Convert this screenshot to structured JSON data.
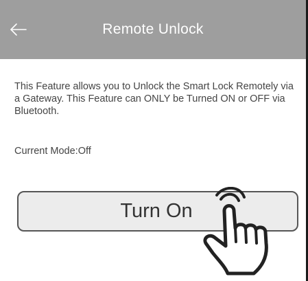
{
  "header": {
    "back_icon": "arrow-left-icon",
    "title": "Remote Unlock",
    "background_color": "#9e9e9e",
    "title_color": "#ffffff"
  },
  "content": {
    "description": "This Feature allows you to Unlock the Smart Lock Remotely via a Gateway. This Feature can ONLY be Turned ON or OFF via Bluetooth.",
    "current_mode_label": "Current Mode:",
    "current_mode_value": "Off"
  },
  "action": {
    "button_label": "Turn On",
    "pointer_icon": "hand-pointer-icon"
  }
}
